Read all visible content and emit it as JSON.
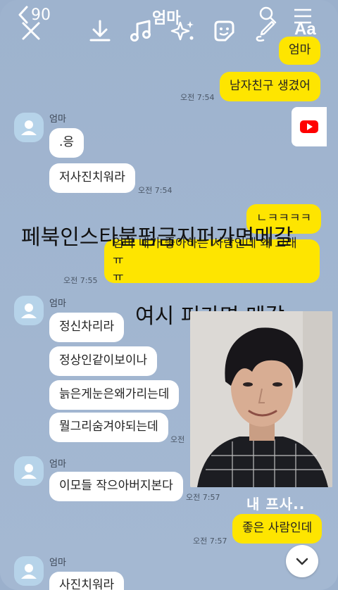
{
  "header": {
    "back_count": "90",
    "title": "엄마",
    "text_tool": "Aa"
  },
  "messages": [
    {
      "id": "m1",
      "from": "me",
      "text": "엄마"
    },
    {
      "id": "m2",
      "from": "me",
      "text": "남자친구 생겼어",
      "time": "오전 7:54"
    },
    {
      "id": "m3",
      "from": "mom",
      "name": "엄마",
      "text": ".응"
    },
    {
      "id": "m4",
      "from": "mom",
      "text": "저사진치워라",
      "time": "오전 7:54"
    },
    {
      "id": "m5",
      "from": "me",
      "text": "ㄴㅋㅋㅋㅋ"
    },
    {
      "id": "m6",
      "from": "me",
      "text_line1": "엄마 내가 좋아하는 사람인데 왜 그래 ㅠ",
      "text_line2": "ㅠ",
      "time": "오전 7:55"
    },
    {
      "id": "m7",
      "from": "mom",
      "name": "엄마",
      "text": "정신차리라"
    },
    {
      "id": "m8",
      "from": "mom",
      "text": "정상인같이보이나"
    },
    {
      "id": "m9",
      "from": "mom",
      "text": "늙은게눈은왜가리는데"
    },
    {
      "id": "m10",
      "from": "mom",
      "text": "뭘그리숨겨야되는데",
      "time": "오전"
    },
    {
      "id": "m11",
      "from": "mom",
      "name": "엄마",
      "text": "이모들 작으아버지본다",
      "time": "오전 7:57"
    },
    {
      "id": "m12",
      "from": "me",
      "text": "좋은 사람인데",
      "time": "오전 7:57"
    },
    {
      "id": "m13",
      "from": "mom",
      "name": "엄마",
      "text": "사진치워라"
    }
  ],
  "overlay": {
    "story_text_1": "페북인스타불펌금지퍼가면메갈",
    "story_text_2": "여시 퍼가면 메갈",
    "photo_caption": "내 프사.."
  },
  "colors": {
    "background": "#9eb3ce",
    "my_bubble": "#fee500",
    "their_bubble": "#ffffff"
  },
  "icons": [
    "back-chevron-icon",
    "search-icon",
    "menu-icon",
    "close-icon",
    "download-icon",
    "music-icon",
    "sparkle-icon",
    "sticker-icon",
    "draw-icon",
    "youtube-icon",
    "chevron-down-icon"
  ]
}
